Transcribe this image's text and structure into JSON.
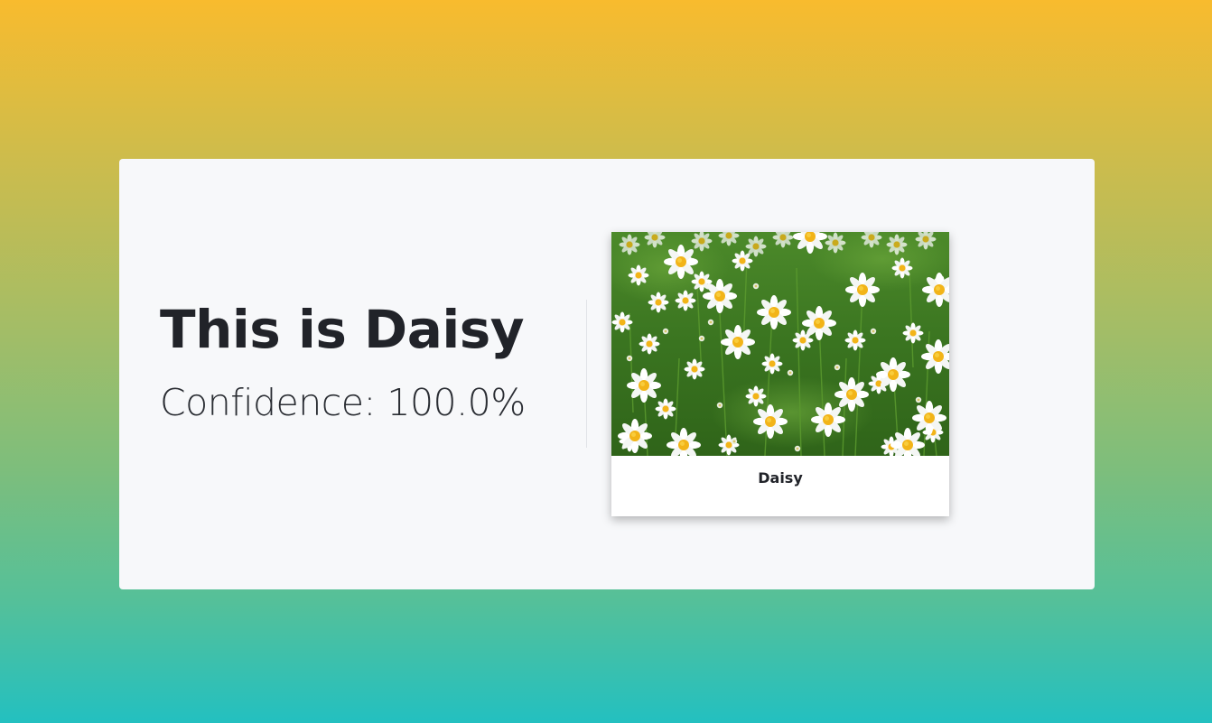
{
  "result": {
    "title": "This is Daisy",
    "confidence": "Confidence: 100.0%"
  },
  "card": {
    "image_subject": "daisy-field-photo",
    "caption": "Daisy"
  },
  "colors": {
    "gradient_top": "#f8bb2e",
    "gradient_bottom": "#23c0c0",
    "panel": "#f7f8fa",
    "text": "#212329",
    "petal": "#ffffff",
    "flower_center": "#f2b418",
    "grass": "#3f7a1e"
  }
}
